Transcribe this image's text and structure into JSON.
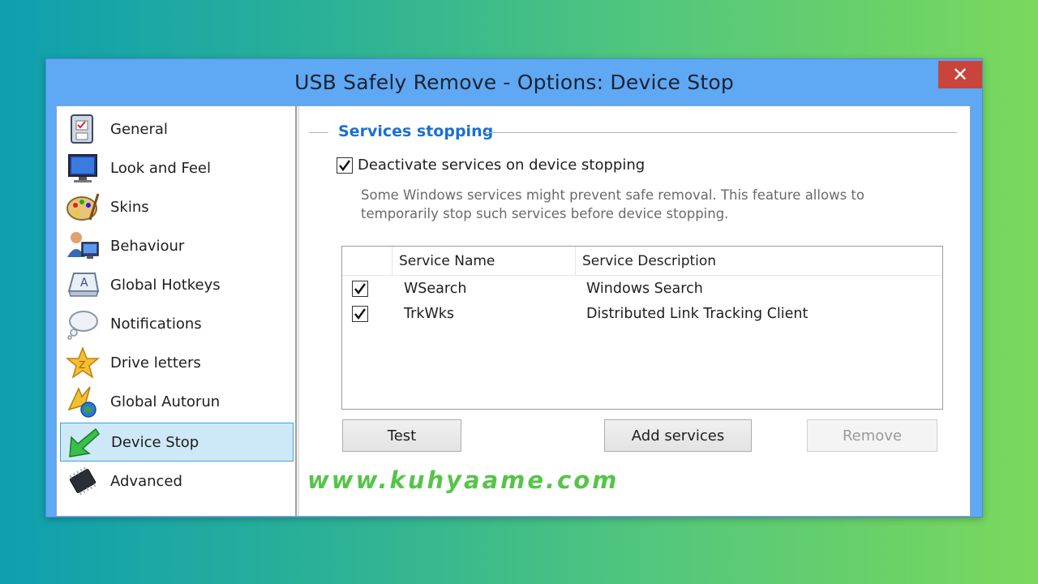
{
  "window": {
    "title": "USB Safely Remove - Options: Device Stop",
    "close_label": "✕"
  },
  "sidebar": {
    "items": [
      {
        "label": "General",
        "icon": "clipboard-icon"
      },
      {
        "label": "Look and Feel",
        "icon": "monitor-icon"
      },
      {
        "label": "Skins",
        "icon": "palette-icon"
      },
      {
        "label": "Behaviour",
        "icon": "user-computer-icon"
      },
      {
        "label": "Global Hotkeys",
        "icon": "keyboard-key-icon"
      },
      {
        "label": "Notifications",
        "icon": "cloud-bubble-icon"
      },
      {
        "label": "Drive letters",
        "icon": "star-icon"
      },
      {
        "label": "Global Autorun",
        "icon": "autorun-globe-icon"
      },
      {
        "label": "Device Stop",
        "icon": "green-arrow-icon"
      },
      {
        "label": "Advanced",
        "icon": "chip-icon"
      }
    ],
    "active": "Device Stop"
  },
  "main": {
    "group_title": "Services stopping",
    "deactivate_label": "Deactivate services on device stopping",
    "deactivate_checked": true,
    "description": "Some Windows services might prevent safe removal. This feature allows to temporarily stop such services before device stopping.",
    "table": {
      "columns": [
        "Service Name",
        "Service Description"
      ],
      "rows": [
        {
          "checked": true,
          "name": "WSearch",
          "description": "Windows Search"
        },
        {
          "checked": true,
          "name": "TrkWks",
          "description": "Distributed Link Tracking Client"
        }
      ]
    },
    "buttons": {
      "test": "Test",
      "add": "Add services",
      "remove": "Remove"
    }
  },
  "watermark": "www.kuhyaame.com",
  "colors": {
    "titlebar": "#5fa8f4",
    "close": "#c9453b",
    "group_title": "#1a6fd4",
    "selection": "#cde8f7",
    "watermark": "#56c44a"
  }
}
